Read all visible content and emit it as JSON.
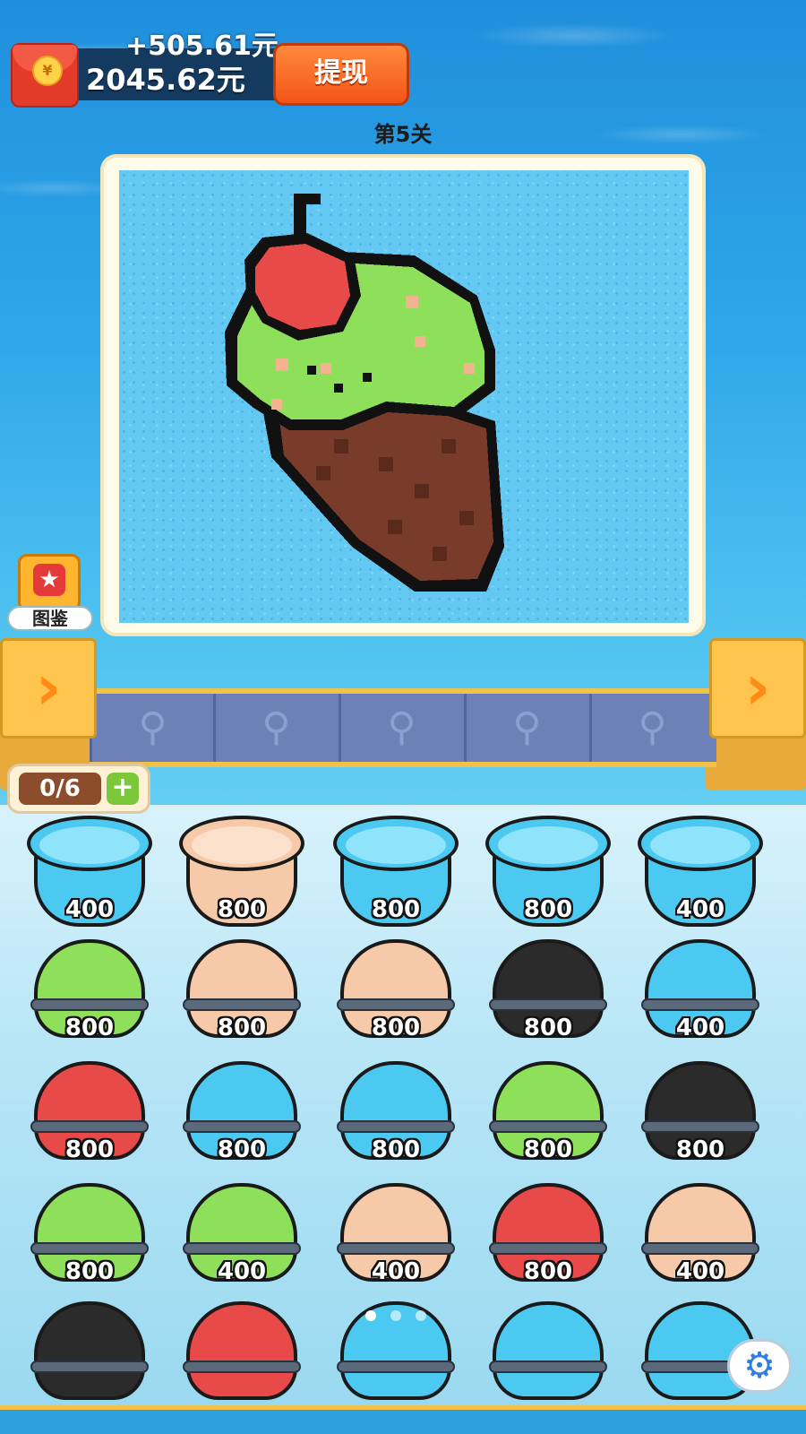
{
  "wallet": {
    "bonus": "+505.61元",
    "balance": "2045.62元",
    "withdraw_label": "提现",
    "coin_symbol": "¥"
  },
  "level_label": "第5关",
  "picture": {
    "subject": "pixel-art ice cream cone with cherry",
    "colors": {
      "cherry": "#e84a4a",
      "scoop": "#8ee05a",
      "cone": "#7a3c2a",
      "outline": "#111111",
      "background": "#63c9f2",
      "sprinkle": "#f2b38e"
    }
  },
  "collection": {
    "label": "图鉴",
    "icon": "star-icon"
  },
  "belt": {
    "slot_icon": "trowel-icon",
    "slots": 5,
    "arrow": "›"
  },
  "slot_counter": {
    "value": "0/6",
    "add": "+"
  },
  "palette": {
    "blue": {
      "fill": "#4cc9f0",
      "inner": "#8fe3fb"
    },
    "peach": {
      "fill": "#f6c9a8",
      "inner": "#fbe0cc"
    },
    "green": {
      "fill": "#8ee05a",
      "inner": "#b8f08a"
    },
    "black": {
      "fill": "#2b2b2b",
      "inner": "#4a4a4a"
    },
    "red": {
      "fill": "#e84a4a",
      "inner": "#f27a7a"
    }
  },
  "buckets": [
    [
      {
        "color": "blue",
        "value": "400",
        "state": "open"
      },
      {
        "color": "peach",
        "value": "800",
        "state": "open"
      },
      {
        "color": "blue",
        "value": "800",
        "state": "open"
      },
      {
        "color": "blue",
        "value": "800",
        "state": "open"
      },
      {
        "color": "blue",
        "value": "400",
        "state": "open"
      }
    ],
    [
      {
        "color": "green",
        "value": "800",
        "state": "closed"
      },
      {
        "color": "peach",
        "value": "800",
        "state": "closed"
      },
      {
        "color": "peach",
        "value": "800",
        "state": "closed"
      },
      {
        "color": "black",
        "value": "800",
        "state": "closed"
      },
      {
        "color": "blue",
        "value": "400",
        "state": "closed"
      }
    ],
    [
      {
        "color": "red",
        "value": "800",
        "state": "closed"
      },
      {
        "color": "blue",
        "value": "800",
        "state": "closed"
      },
      {
        "color": "blue",
        "value": "800",
        "state": "closed"
      },
      {
        "color": "green",
        "value": "800",
        "state": "closed"
      },
      {
        "color": "black",
        "value": "800",
        "state": "closed"
      }
    ],
    [
      {
        "color": "green",
        "value": "800",
        "state": "closed"
      },
      {
        "color": "green",
        "value": "400",
        "state": "closed"
      },
      {
        "color": "peach",
        "value": "400",
        "state": "closed"
      },
      {
        "color": "red",
        "value": "800",
        "state": "closed"
      },
      {
        "color": "peach",
        "value": "400",
        "state": "closed"
      }
    ],
    [
      {
        "color": "black",
        "value": "",
        "state": "closed"
      },
      {
        "color": "red",
        "value": "",
        "state": "closed"
      },
      {
        "color": "blue",
        "value": "",
        "state": "closed"
      },
      {
        "color": "blue",
        "value": "",
        "state": "closed"
      },
      {
        "color": "blue",
        "value": "",
        "state": "closed"
      }
    ]
  ],
  "settings_icon": "gear-icon"
}
